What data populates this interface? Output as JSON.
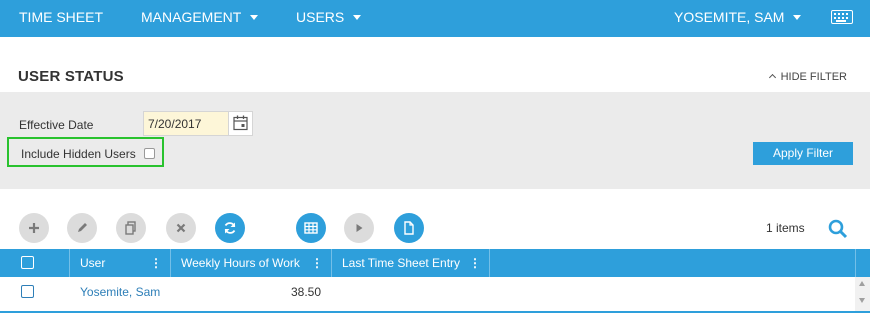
{
  "nav": {
    "timesheet": "TIME SHEET",
    "management": "MANAGEMENT",
    "users": "USERS",
    "user_menu": "YOSEMITE, SAM"
  },
  "page": {
    "title": "USER STATUS",
    "hide_filter": "HIDE FILTER"
  },
  "filter": {
    "effective_date_label": "Effective Date",
    "effective_date_value": "7/20/2017",
    "include_hidden_label": "Include Hidden Users",
    "include_hidden_checked": false,
    "apply_label": "Apply Filter"
  },
  "toolbar": {
    "items_count": "1 items"
  },
  "grid": {
    "columns": [
      "User",
      "Weekly Hours of Work",
      "Last Time Sheet Entry"
    ],
    "rows": [
      {
        "user": "Yosemite, Sam",
        "weekly_hours": "38.50",
        "last_entry": ""
      }
    ]
  },
  "colors": {
    "brand": "#2e9fdb",
    "highlight": "#29c22e",
    "link": "#2e7fb8"
  },
  "icons": [
    "keyboard-icon",
    "calendar-icon",
    "add-icon",
    "edit-icon",
    "copy-icon",
    "delete-icon",
    "refresh-icon",
    "grid-icon",
    "play-icon",
    "document-icon",
    "search-icon"
  ]
}
